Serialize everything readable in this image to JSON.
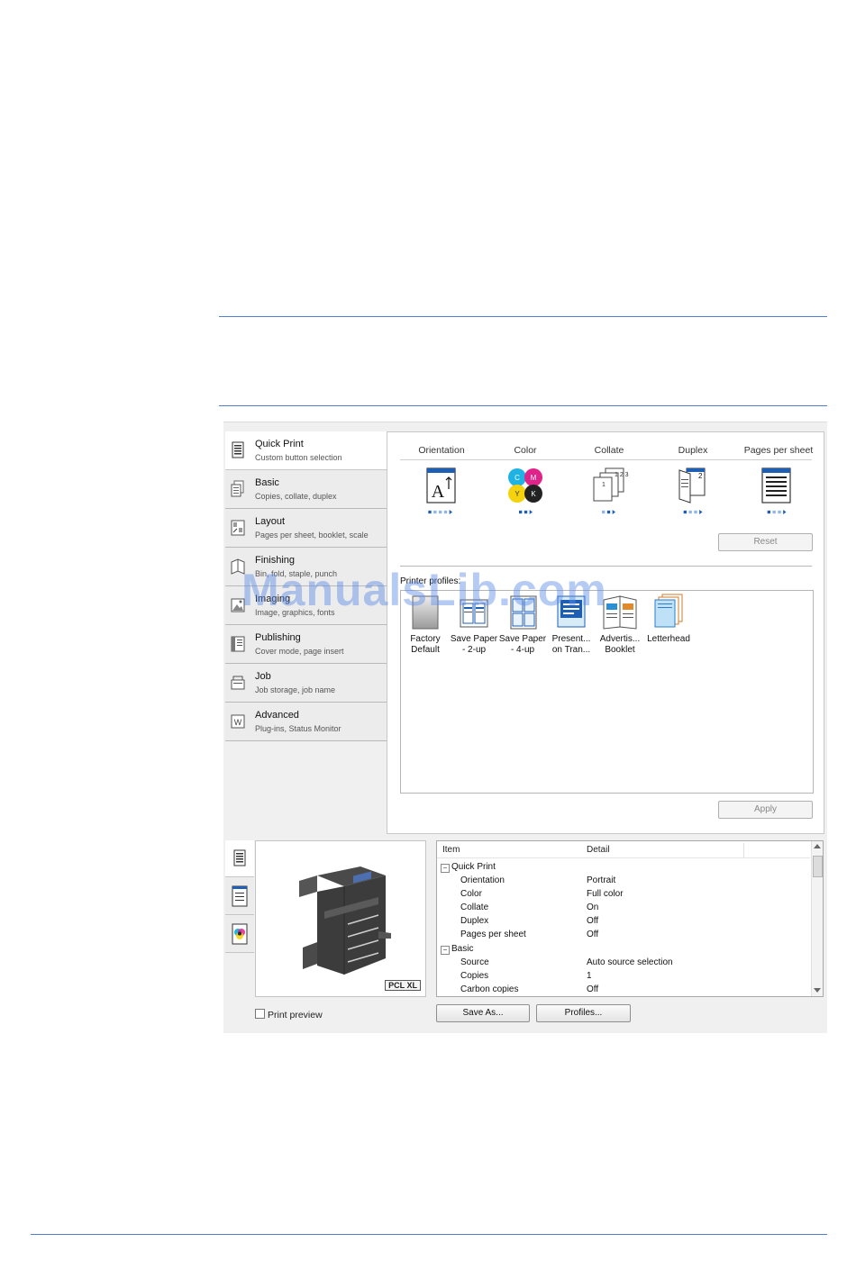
{
  "quick_print_tab": {
    "columns": [
      "Orientation",
      "Color",
      "Collate",
      "Duplex",
      "Pages per sheet"
    ],
    "reset_label": "Reset",
    "profiles_label": "Printer profiles:",
    "profiles": [
      {
        "line1": "Factory",
        "line2": "Default"
      },
      {
        "line1": "Save Paper",
        "line2": "- 2-up"
      },
      {
        "line1": "Save Paper",
        "line2": "- 4-up"
      },
      {
        "line1": "Present...",
        "line2": "on Tran..."
      },
      {
        "line1": "Advertis...",
        "line2": "Booklet"
      },
      {
        "line1": "Letterhead",
        "line2": ""
      }
    ],
    "apply_label": "Apply"
  },
  "sidebar": {
    "items": [
      {
        "title": "Quick Print",
        "subtitle": "Custom button selection",
        "icon": "quick-print-icon"
      },
      {
        "title": "Basic",
        "subtitle": "Copies, collate, duplex",
        "icon": "basic-icon"
      },
      {
        "title": "Layout",
        "subtitle": "Pages per sheet, booklet, scale",
        "icon": "layout-icon"
      },
      {
        "title": "Finishing",
        "subtitle": "Bin, fold, staple, punch",
        "icon": "finishing-icon"
      },
      {
        "title": "Imaging",
        "subtitle": "Image, graphics, fonts",
        "icon": "imaging-icon"
      },
      {
        "title": "Publishing",
        "subtitle": "Cover mode, page insert",
        "icon": "publishing-icon"
      },
      {
        "title": "Job",
        "subtitle": "Job storage, job name",
        "icon": "job-icon"
      },
      {
        "title": "Advanced",
        "subtitle": "Plug-ins, Status Monitor",
        "icon": "advanced-icon"
      }
    ]
  },
  "preview": {
    "badge": "PCL XL",
    "print_preview_label": "Print preview",
    "print_preview_checked": false
  },
  "summary": {
    "headers": {
      "item": "Item",
      "detail": "Detail"
    },
    "groups": [
      {
        "name": "Quick Print",
        "rows": [
          {
            "item": "Orientation",
            "detail": "Portrait"
          },
          {
            "item": "Color",
            "detail": "Full color"
          },
          {
            "item": "Collate",
            "detail": "On"
          },
          {
            "item": "Duplex",
            "detail": "Off"
          },
          {
            "item": "Pages per sheet",
            "detail": "Off"
          }
        ]
      },
      {
        "name": "Basic",
        "rows": [
          {
            "item": "Source",
            "detail": "Auto source selection"
          },
          {
            "item": "Copies",
            "detail": "1"
          },
          {
            "item": "Carbon copies",
            "detail": "Off"
          }
        ]
      }
    ],
    "save_as_label": "Save As...",
    "profiles_button_label": "Profiles..."
  },
  "watermark": "ManualsLib.com",
  "colors": {
    "rule": "#4f7fd0",
    "accent_blue": "#1e5fb4"
  }
}
